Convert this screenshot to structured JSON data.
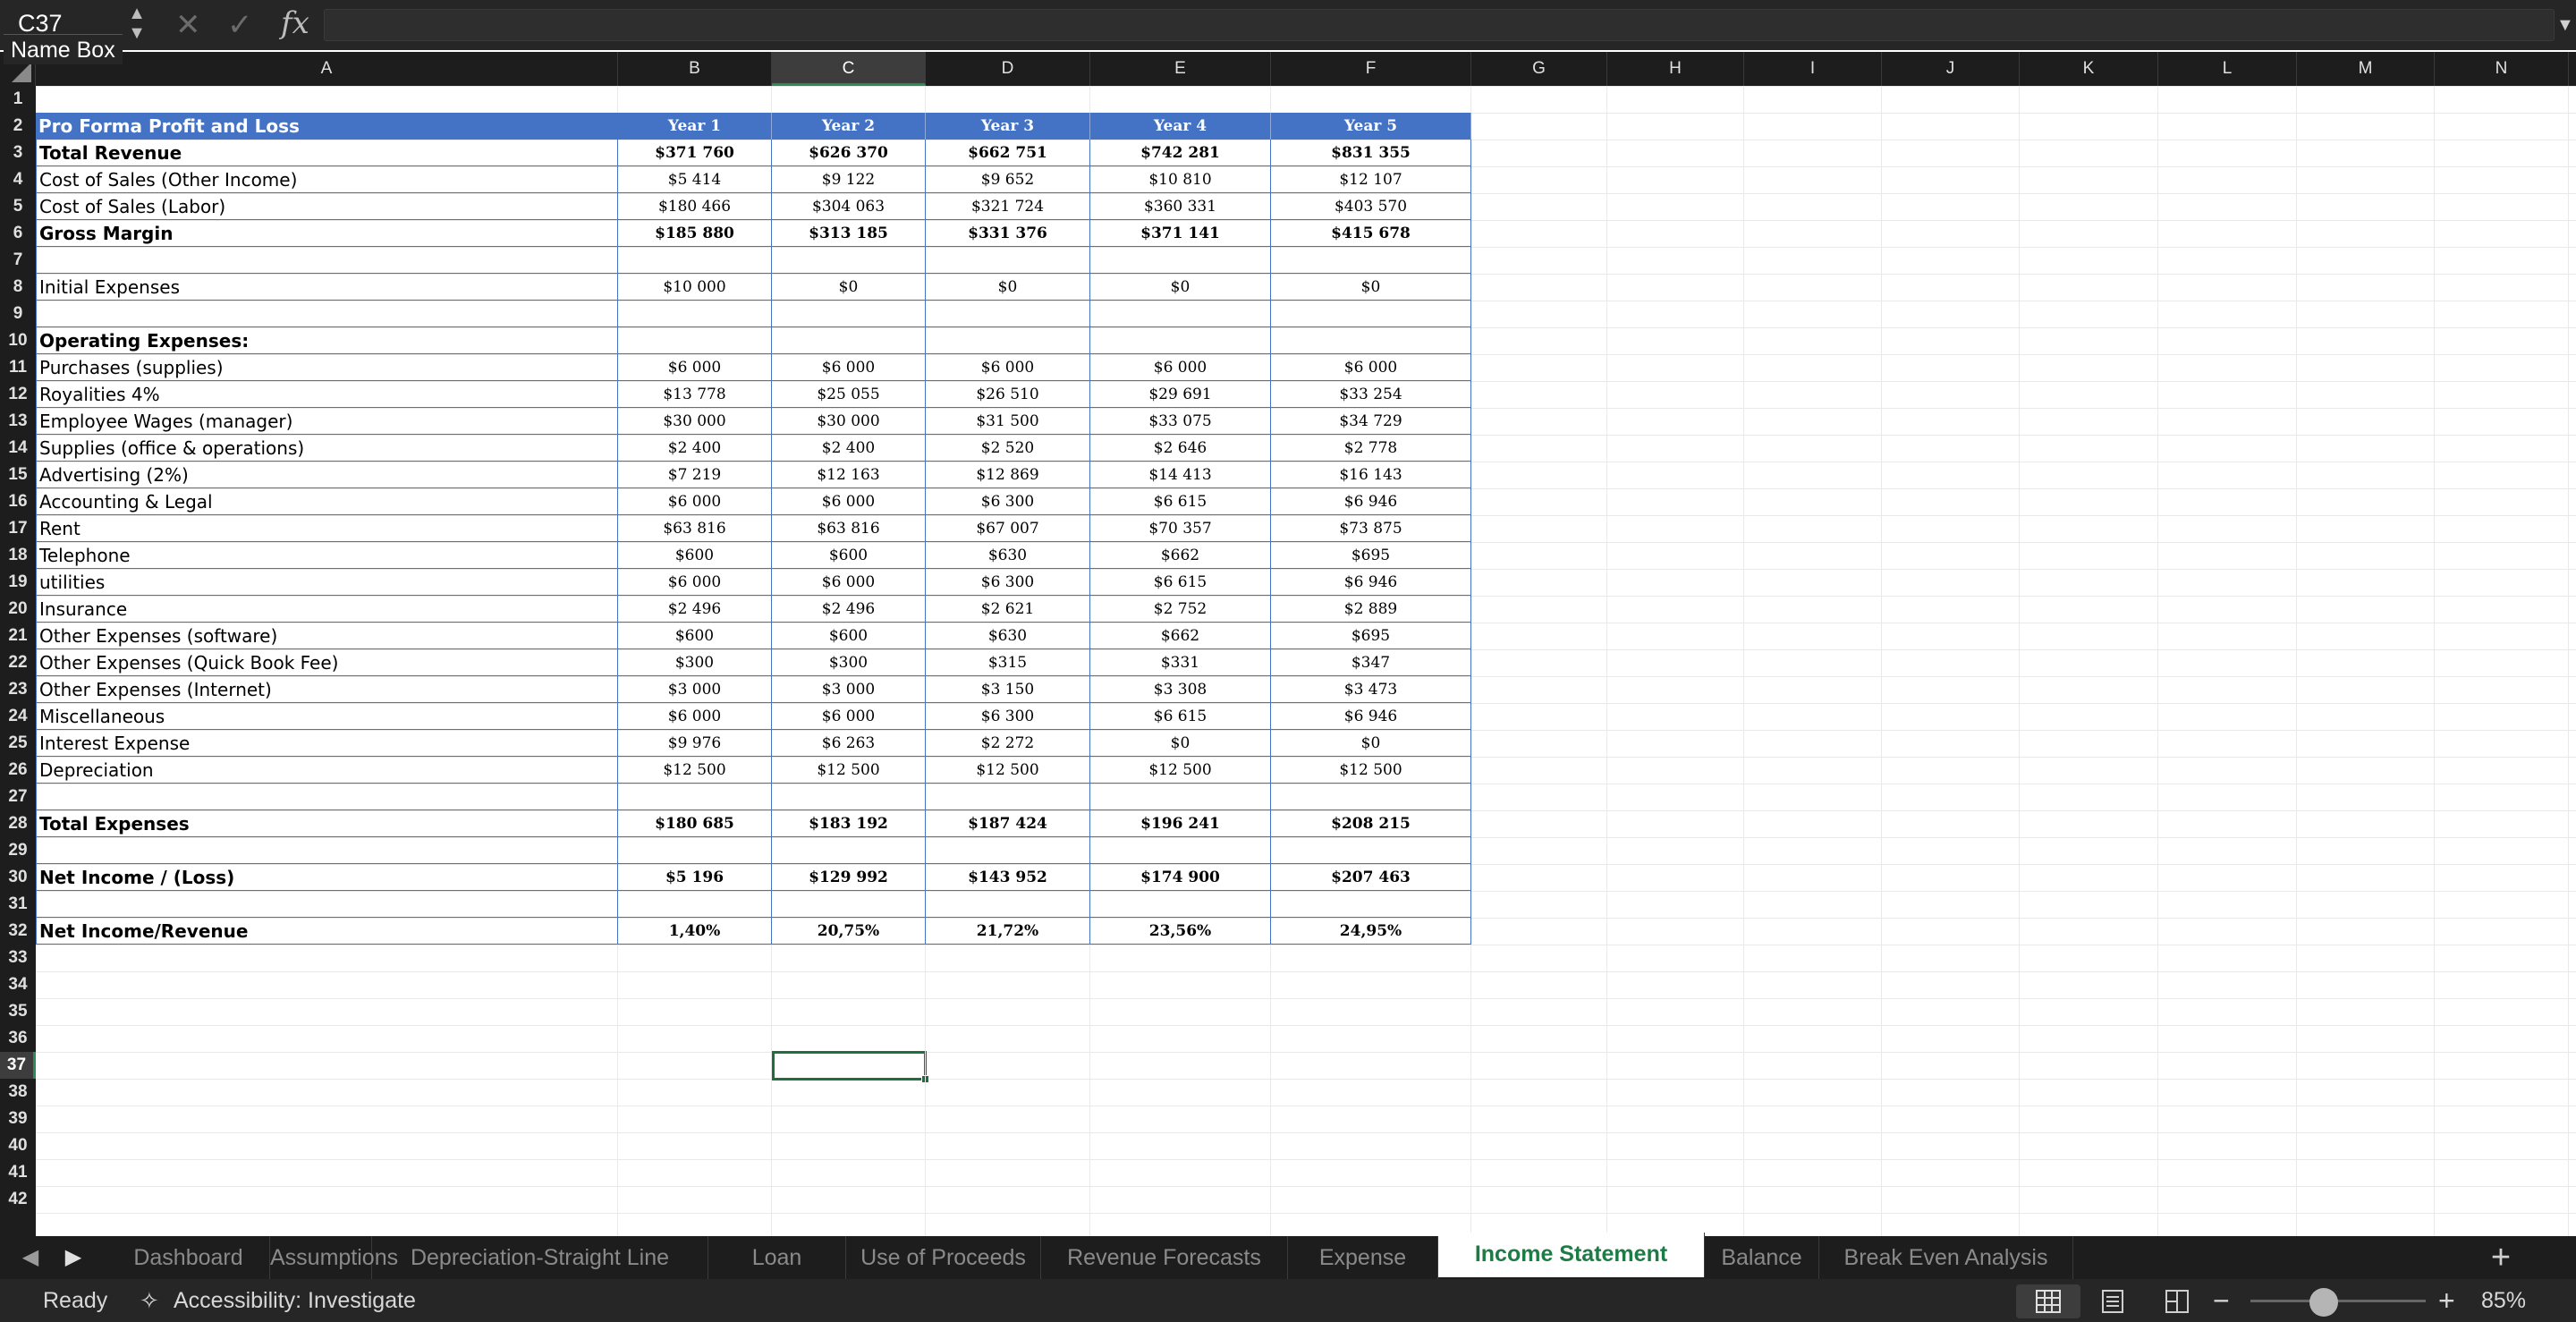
{
  "formula_bar": {
    "name_box": "C37",
    "name_box_tooltip": "Name Box",
    "fx_label": "fx",
    "formula": ""
  },
  "columns": [
    "A",
    "B",
    "C",
    "D",
    "E",
    "F",
    "G",
    "H",
    "I",
    "J",
    "K",
    "L",
    "M",
    "N"
  ],
  "active_column": "C",
  "active_row": "37",
  "rows": [
    "1",
    "2",
    "3",
    "4",
    "5",
    "6",
    "7",
    "8",
    "9",
    "10",
    "11",
    "12",
    "13",
    "14",
    "15",
    "16",
    "17",
    "18",
    "19",
    "20",
    "21",
    "22",
    "23",
    "24",
    "25",
    "26",
    "27",
    "28",
    "29",
    "30",
    "31",
    "32",
    "33",
    "34",
    "35",
    "36",
    "37",
    "38",
    "39",
    "40",
    "41",
    "42"
  ],
  "table": {
    "title": "Pro Forma Profit and Loss",
    "years": [
      "Year 1",
      "Year 2",
      "Year 3",
      "Year 4",
      "Year 5"
    ],
    "lines": [
      {
        "row": 3,
        "label": "Total Revenue",
        "bold": true,
        "values": [
          "$371 760",
          "$626 370",
          "$662 751",
          "$742 281",
          "$831 355"
        ]
      },
      {
        "row": 4,
        "label": "Cost of Sales (Other Income)",
        "bold": false,
        "values": [
          "$5 414",
          "$9 122",
          "$9 652",
          "$10 810",
          "$12 107"
        ]
      },
      {
        "row": 5,
        "label": "Cost of Sales (Labor)",
        "bold": false,
        "values": [
          "$180 466",
          "$304 063",
          "$321 724",
          "$360 331",
          "$403 570"
        ]
      },
      {
        "row": 6,
        "label": "Gross Margin",
        "bold": true,
        "values": [
          "$185 880",
          "$313 185",
          "$331 376",
          "$371 141",
          "$415 678"
        ]
      },
      {
        "row": 7,
        "label": "",
        "bold": false,
        "values": [
          "",
          "",
          "",
          "",
          ""
        ]
      },
      {
        "row": 8,
        "label": "Initial Expenses",
        "bold": false,
        "values": [
          "$10 000",
          "$0",
          "$0",
          "$0",
          "$0"
        ]
      },
      {
        "row": 9,
        "label": "",
        "bold": false,
        "values": [
          "",
          "",
          "",
          "",
          ""
        ]
      },
      {
        "row": 10,
        "label": "Operating Expenses:",
        "bold": true,
        "values": [
          "",
          "",
          "",
          "",
          ""
        ]
      },
      {
        "row": 11,
        "label": "Purchases (supplies)",
        "bold": false,
        "values": [
          "$6 000",
          "$6 000",
          "$6 000",
          "$6 000",
          "$6 000"
        ]
      },
      {
        "row": 12,
        "label": "Royalities 4%",
        "bold": false,
        "values": [
          "$13 778",
          "$25 055",
          "$26 510",
          "$29 691",
          "$33 254"
        ]
      },
      {
        "row": 13,
        "label": "Employee Wages (manager)",
        "bold": false,
        "values": [
          "$30 000",
          "$30 000",
          "$31 500",
          "$33 075",
          "$34 729"
        ]
      },
      {
        "row": 14,
        "label": "Supplies (office & operations)",
        "bold": false,
        "values": [
          "$2 400",
          "$2 400",
          "$2 520",
          "$2 646",
          "$2 778"
        ]
      },
      {
        "row": 15,
        "label": "Advertising (2%)",
        "bold": false,
        "values": [
          "$7 219",
          "$12 163",
          "$12 869",
          "$14 413",
          "$16 143"
        ]
      },
      {
        "row": 16,
        "label": "Accounting & Legal",
        "bold": false,
        "values": [
          "$6 000",
          "$6 000",
          "$6 300",
          "$6 615",
          "$6 946"
        ]
      },
      {
        "row": 17,
        "label": "Rent",
        "bold": false,
        "values": [
          "$63 816",
          "$63 816",
          "$67 007",
          "$70 357",
          "$73 875"
        ]
      },
      {
        "row": 18,
        "label": "Telephone",
        "bold": false,
        "values": [
          "$600",
          "$600",
          "$630",
          "$662",
          "$695"
        ]
      },
      {
        "row": 19,
        "label": "utilities",
        "bold": false,
        "values": [
          "$6 000",
          "$6 000",
          "$6 300",
          "$6 615",
          "$6 946"
        ]
      },
      {
        "row": 20,
        "label": "Insurance",
        "bold": false,
        "values": [
          "$2 496",
          "$2 496",
          "$2 621",
          "$2 752",
          "$2 889"
        ]
      },
      {
        "row": 21,
        "label": "Other Expenses (software)",
        "bold": false,
        "values": [
          "$600",
          "$600",
          "$630",
          "$662",
          "$695"
        ]
      },
      {
        "row": 22,
        "label": "Other Expenses (Quick Book Fee)",
        "bold": false,
        "values": [
          "$300",
          "$300",
          "$315",
          "$331",
          "$347"
        ]
      },
      {
        "row": 23,
        "label": "Other Expenses (Internet)",
        "bold": false,
        "values": [
          "$3 000",
          "$3 000",
          "$3 150",
          "$3 308",
          "$3 473"
        ]
      },
      {
        "row": 24,
        "label": "Miscellaneous",
        "bold": false,
        "values": [
          "$6 000",
          "$6 000",
          "$6 300",
          "$6 615",
          "$6 946"
        ]
      },
      {
        "row": 25,
        "label": "Interest Expense",
        "bold": false,
        "values": [
          "$9 976",
          "$6 263",
          "$2 272",
          "$0",
          "$0"
        ]
      },
      {
        "row": 26,
        "label": "Depreciation",
        "bold": false,
        "values": [
          "$12 500",
          "$12 500",
          "$12 500",
          "$12 500",
          "$12 500"
        ]
      },
      {
        "row": 27,
        "label": "",
        "bold": false,
        "values": [
          "",
          "",
          "",
          "",
          ""
        ]
      },
      {
        "row": 28,
        "label": "Total Expenses",
        "bold": true,
        "values": [
          "$180 685",
          "$183 192",
          "$187 424",
          "$196 241",
          "$208 215"
        ]
      },
      {
        "row": 29,
        "label": "",
        "bold": false,
        "values": [
          "",
          "",
          "",
          "",
          ""
        ]
      },
      {
        "row": 30,
        "label": "Net Income / (Loss)",
        "bold": true,
        "values": [
          "$5 196",
          "$129 992",
          "$143 952",
          "$174 900",
          "$207 463"
        ]
      },
      {
        "row": 31,
        "label": "",
        "bold": false,
        "values": [
          "",
          "",
          "",
          "",
          ""
        ]
      },
      {
        "row": 32,
        "label": "Net Income/Revenue",
        "bold": true,
        "values": [
          "1,40%",
          "20,75%",
          "21,72%",
          "23,56%",
          "24,95%"
        ]
      }
    ]
  },
  "sheet_tabs": [
    "Dashboard",
    "Assumptions",
    "Depreciation-Straight Line",
    "Loan Schedule",
    "Use of Proceeds",
    "Revenue Forecasts",
    "Expense Sheet",
    "Income Statement",
    "Balance Sheet",
    "Break Even Analysis"
  ],
  "active_tab": "Income Statement",
  "status": {
    "ready": "Ready",
    "accessibility": "Accessibility: Investigate",
    "zoom": "85%",
    "zoom_level": 0.85
  },
  "colors": {
    "table_header": "#4472c4",
    "table_border": "#4472c4",
    "selection": "#1e6e3e",
    "active_tab_text": "#1e7b45"
  }
}
